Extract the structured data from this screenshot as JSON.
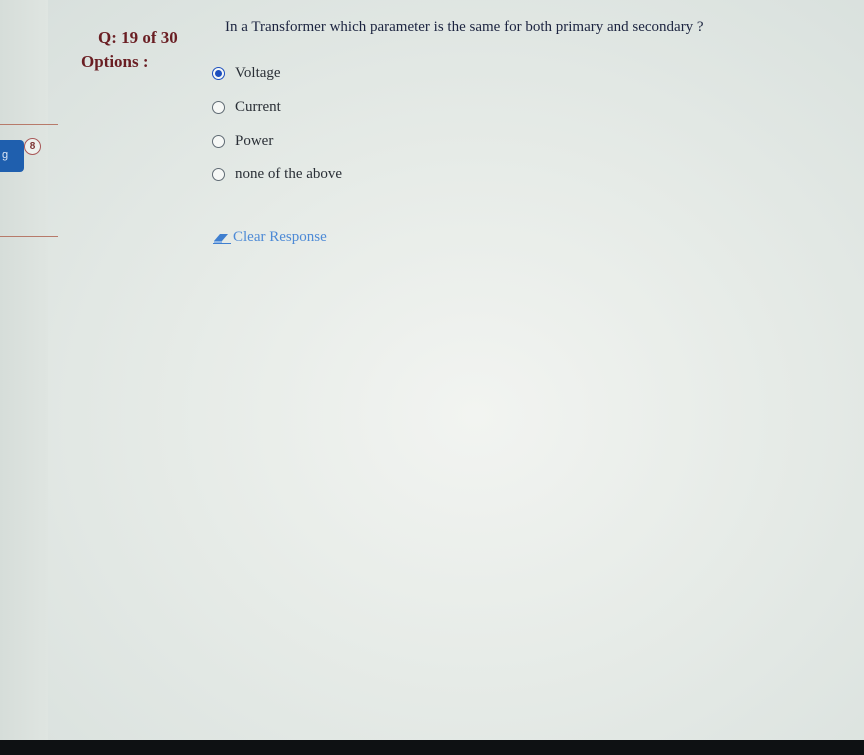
{
  "question": {
    "number_label": "Q: 19 of 30",
    "text": "In a Transformer which parameter is the same for both primary and secondary ?",
    "options_label": "Options :"
  },
  "options": [
    {
      "label": "Voltage",
      "selected": true
    },
    {
      "label": "Current",
      "selected": false
    },
    {
      "label": "Power",
      "selected": false
    },
    {
      "label": "none of the above",
      "selected": false
    }
  ],
  "clear_response_label": "Clear Response",
  "sidebar": {
    "tab_label": "g",
    "badge_count": "8"
  },
  "colors": {
    "heading": "#6a1e23",
    "radio_selected": "#1d4fbf",
    "link": "#4d8ad6",
    "tab": "#1f5fae"
  }
}
